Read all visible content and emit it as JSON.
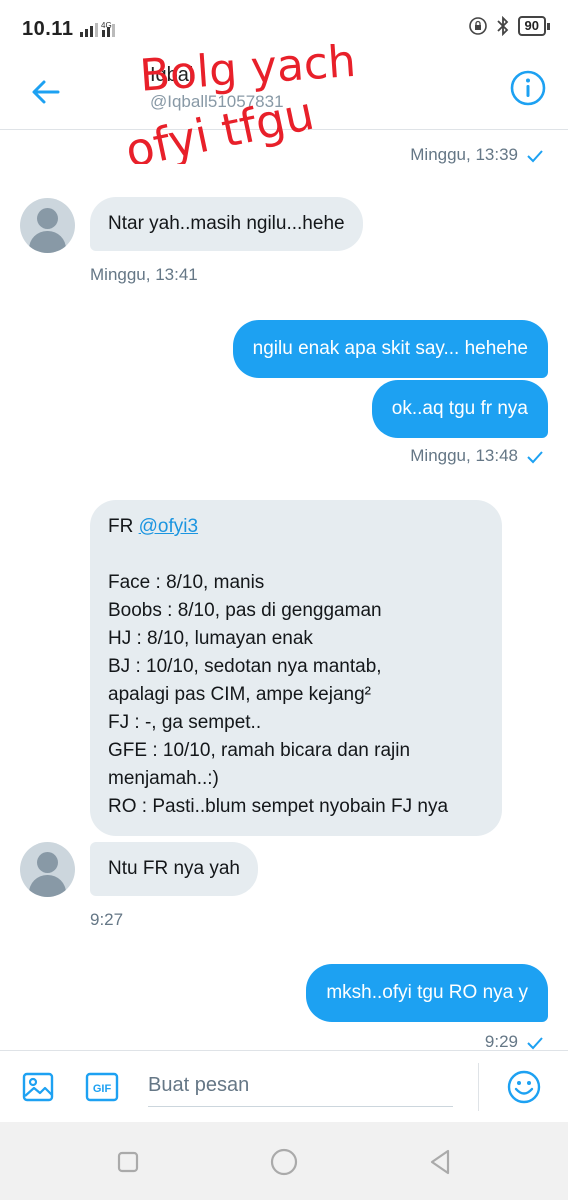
{
  "status_bar": {
    "time": "10.11",
    "network": "4G",
    "battery": "90"
  },
  "header": {
    "name": "Iqbal",
    "handle": "@Iqball51057831",
    "overlay_text_1": "Bolg yach",
    "overlay_text_2": "ofyi tfgu"
  },
  "messages": {
    "m0_time": "Minggu, 13:39",
    "m1_text": "Ntar yah..masih ngilu...hehe",
    "m1_time": "Minggu, 13:41",
    "m2_text": "ngilu enak apa skit say... hehehe",
    "m3_text": "ok..aq tgu fr nya",
    "m3_time": "Minggu, 13:48",
    "report": {
      "title_prefix": "FR ",
      "mention": "@ofyi3",
      "lines": [
        "Face : 8/10, manis",
        "Boobs : 8/10, pas di genggaman",
        "HJ : 8/10, lumayan enak",
        "BJ : 10/10, sedotan nya mantab,",
        "apalagi pas CIM, ampe kejang²",
        "FJ : -, ga sempet..",
        "GFE : 10/10, ramah bicara dan rajin",
        "menjamah..:)",
        "RO : Pasti..blum sempet nyobain FJ nya"
      ]
    },
    "m5_text": "Ntu FR nya yah",
    "m5_time": "9:27",
    "m6_text": "mksh..ofyi tgu RO nya y",
    "m6_time": "9:29"
  },
  "compose": {
    "placeholder": "Buat pesan",
    "gif_label": "GIF"
  },
  "colors": {
    "accent": "#1da1f2",
    "incoming_bubble": "#e6ecf0",
    "scribble": "#e8202a"
  }
}
